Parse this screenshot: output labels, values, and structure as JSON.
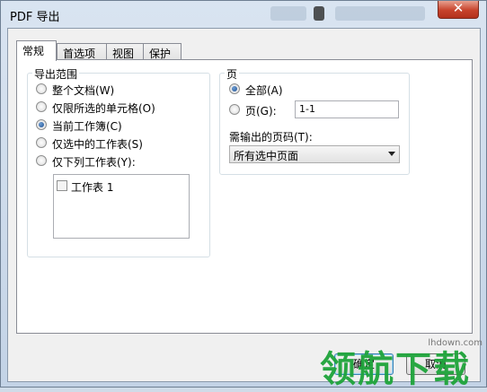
{
  "window": {
    "title": "PDF 导出",
    "close_glyph": "✕"
  },
  "tabs": [
    {
      "label": "常规",
      "active": true
    },
    {
      "label": "首选项",
      "active": false
    },
    {
      "label": "视图",
      "active": false
    },
    {
      "label": "保护",
      "active": false
    }
  ],
  "export_range": {
    "title": "导出范围",
    "options": [
      {
        "label": "整个文档(W)",
        "checked": false
      },
      {
        "label": "仅限所选的单元格(O)",
        "checked": false
      },
      {
        "label": "当前工作簿(C)",
        "checked": true
      },
      {
        "label": "仅选中的工作表(S)",
        "checked": false
      },
      {
        "label": "仅下列工作表(Y):",
        "checked": false
      }
    ],
    "sheets": [
      {
        "label": "工作表 1",
        "checked": false
      }
    ]
  },
  "pages": {
    "title": "页",
    "all_label": "全部(A)",
    "all_checked": true,
    "range_label": "页(G):",
    "range_checked": false,
    "range_value": "1-1",
    "output_label": "需输出的页码(T):",
    "output_selected": "所有选中页面"
  },
  "buttons": {
    "ok": "确定",
    "cancel": "取消"
  },
  "watermark": {
    "text": "领航下载",
    "url": "lhdown.com"
  }
}
